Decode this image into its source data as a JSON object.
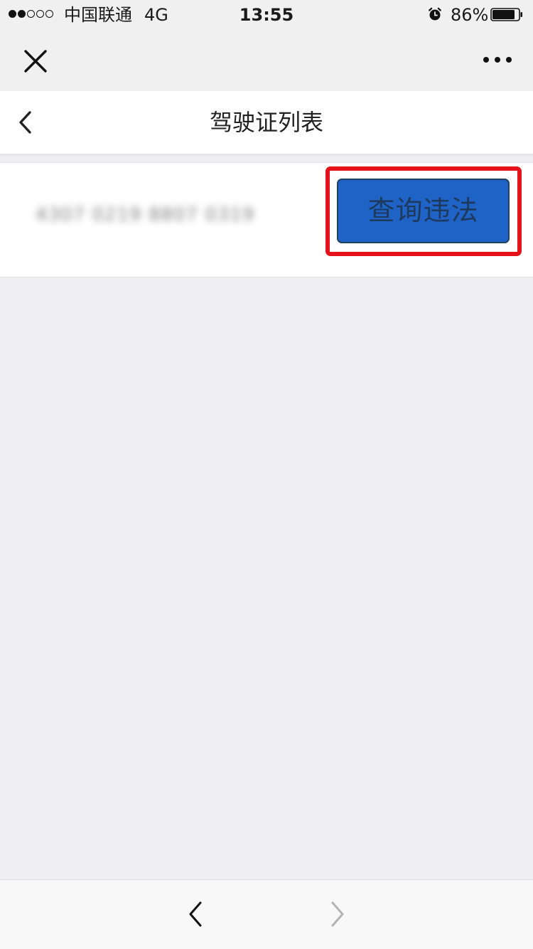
{
  "status_bar": {
    "signal_dots_filled": 2,
    "signal_dots_total": 5,
    "carrier": "中国联通",
    "network": "4G",
    "time": "13:55",
    "alarm_icon": "alarm-clock-icon",
    "battery_percent": "86%",
    "battery_level": 0.86
  },
  "webview_bar": {
    "close_icon": "close-icon",
    "more_icon": "more-dots-icon"
  },
  "header": {
    "back_icon": "chevron-left-icon",
    "title": "驾驶证列表"
  },
  "license_list": [
    {
      "number": "4307 0219 8807 0319",
      "number_blurred": true,
      "action_label": "查询违法",
      "highlighted": true
    }
  ],
  "toolbar": {
    "back_icon": "chevron-left-icon",
    "forward_icon": "chevron-right-icon",
    "forward_enabled": false
  },
  "colors": {
    "page_background": "#efeff1",
    "button_fill": "#1f63c6",
    "button_text": "#1d3a5e",
    "highlight_border": "#e3121b"
  }
}
